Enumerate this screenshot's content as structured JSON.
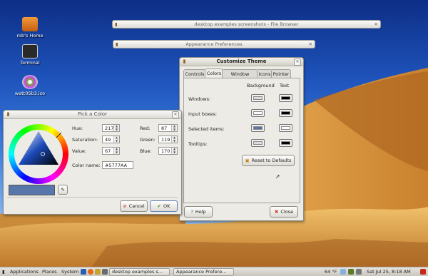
{
  "desktop": {
    "icons": [
      {
        "label": "rob's Home",
        "icon": "home-folder-icon"
      },
      {
        "label": "Terminal",
        "icon": "terminal-icon"
      },
      {
        "label": "watt0Sb3.iso",
        "icon": "disc-image-icon"
      }
    ],
    "minimized_windows": {
      "file_browser": "desktop examples screenshots - File Browser",
      "appearance": "Appearance Preferences"
    }
  },
  "color_dialog": {
    "title": "Pick a Color",
    "fields": {
      "hue_label": "Hue:",
      "hue_value": "217",
      "saturation_label": "Saturation:",
      "saturation_value": "49",
      "value_label": "Value:",
      "value_value": "67",
      "red_label": "Red:",
      "red_value": "87",
      "green_label": "Green:",
      "green_value": "119",
      "blue_label": "Blue:",
      "blue_value": "170",
      "color_name_label": "Color name:",
      "color_name_value": "#5777AA"
    },
    "current_color": "#5777AA",
    "cancel_label": "Cancel",
    "ok_label": "OK"
  },
  "theme_dialog": {
    "title": "Customize Theme",
    "tabs": [
      "Controls",
      "Colors",
      "Window Border",
      "Icons",
      "Pointer"
    ],
    "selected_tab": "Colors",
    "columns": {
      "background": "Background",
      "text": "Text"
    },
    "rows": [
      {
        "label": "Windows:",
        "bg": "#dcdcdc",
        "fg": "#000000"
      },
      {
        "label": "Input boxes:",
        "bg": "#ffffff",
        "fg": "#000000"
      },
      {
        "label": "Selected items:",
        "bg": "#5777AA",
        "fg": "#ffffff"
      },
      {
        "label": "Tooltips:",
        "bg": "#dcdcdc",
        "fg": "#000000"
      }
    ],
    "reset_label": "Reset to Defaults",
    "help_label": "Help",
    "close_label": "Close"
  },
  "panel": {
    "menus": [
      "Applications",
      "Places",
      "System"
    ],
    "tasks": [
      "desktop examples s...",
      "Appearance Prefere..."
    ],
    "temperature": "64 °F",
    "clock": "Sat Jul 25,  8:18 AM"
  },
  "colors": {
    "sky_top": "#0d2e86",
    "sand": "#d99a3a",
    "dialog_bg": "#ecebe6"
  }
}
